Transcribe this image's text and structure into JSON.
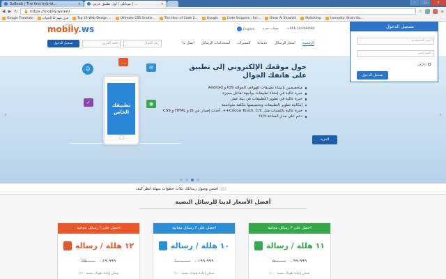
{
  "browser": {
    "tabs": [
      {
        "title": "SoBeeb | The first hybrid...",
        "active": false
      },
      {
        "title": "موبايلي | أول تطبيق عربي | ...",
        "active": true
      },
      {
        "title": "",
        "active": false
      }
    ],
    "url": "https://mobily.ws/en/",
    "bookmarks": [
      "Google Translate",
      "فرن مهم لتا الجواب",
      "Top 10 Web Design ...",
      "Ultimate CSS Gradie...",
      "The Hour of Code 2...",
      "Google",
      "Code Snippets - Sni...",
      "Omar Al Shawish",
      "Mailchimp",
      "Lumosity: Brain Ga..."
    ]
  },
  "header": {
    "logo_main": "mobily",
    "logo_tld": ".ws",
    "logo_sub": "موبايلي",
    "top_links": {
      "language": "English",
      "new_account": "حساب جديد",
      "contact": "+966-544498480"
    },
    "signup_label": "تسجيل الدخول",
    "password_placeholder": "كلمة المرور",
    "phone_placeholder": "رقم الجوال",
    "nav": [
      {
        "label": "الرئيسية",
        "active": true
      },
      {
        "label": "أسعار الرسائل",
        "active": false
      },
      {
        "label": "خدماتنا",
        "active": false
      },
      {
        "label": "المميزات",
        "active": false
      },
      {
        "label": "استخدامات الرسائل",
        "active": false
      },
      {
        "label": "اتصل بنا",
        "active": false
      }
    ]
  },
  "login": {
    "title": "تسجيل الدخول",
    "username_placeholder": "اسم المستخدم",
    "password_placeholder": "كلمة السر",
    "remember": "تذكرني",
    "submit": "تسجيل الدخول"
  },
  "hero": {
    "title": "حول موقعك الإلكتروني إلى تطبيق على هاتفك الجوال",
    "bullets": [
      "متخصصين بإنشاء تطبيقات للهواتف الجوالة IOS و Android",
      "خبرة عالية في إنشاء تطبيقات بواجهة تفاعل مميزة",
      "خبرة عالية في تطوير التطبيقات في بيئة عمل",
      "إمكانية تطوير التطبيقات وتخصيصها بتكلفة متواضعة",
      "خبرة عالية بالتقنيات مثل Cocoa Touch, C/C++, أحدث إصدار من JS و HTML و CSS",
      "دعم على مدار الساعة ٢٤/٧"
    ],
    "more_button": "المزيد",
    "phone_text": "تطبيقك الخاص",
    "slides": 4,
    "active_slide": 2
  },
  "ticker": "اضمن وصول رسائلك بثلاث خطوات سهلة انظر كيف",
  "pricing": {
    "title": "أفضل الأسعار لدينا للرسائل النصية",
    "cards": [
      {
        "head": "احصل على ٣ رسائل مجانية",
        "price": "١٢ هللة / رسالة",
        "range_from": "٢٥،٠٠٠",
        "range_to": "٤٩،٩٩٩",
        "note": "ضمان إعادة نقودك بنسبة ١٠٠٪",
        "color": "#e8572a"
      },
      {
        "head": "احصل على ٣ رسائل مجانية",
        "price": "١٠ هللة / رسالة",
        "range_from": "١٠٠،٠٠٠",
        "range_to": "١٩٩،٩٩٩",
        "note": "ضمان إعادة نقودك بنسبة ١٠٠٪",
        "color": "#2c8fd6"
      },
      {
        "head": "احصل على ٣ رسائل مجانية",
        "price": "١١ هللة / رسالة",
        "range_from": "٥٠،٠٠٠",
        "range_to": "٩٩،٩٩٩",
        "note": "ضمان إعادة نقودك بنسبة ١٠٠٪",
        "color": "#36a84a"
      }
    ]
  },
  "colors": {
    "brand_blue": "#1d5fae",
    "brand_orange": "#e85a1f"
  }
}
